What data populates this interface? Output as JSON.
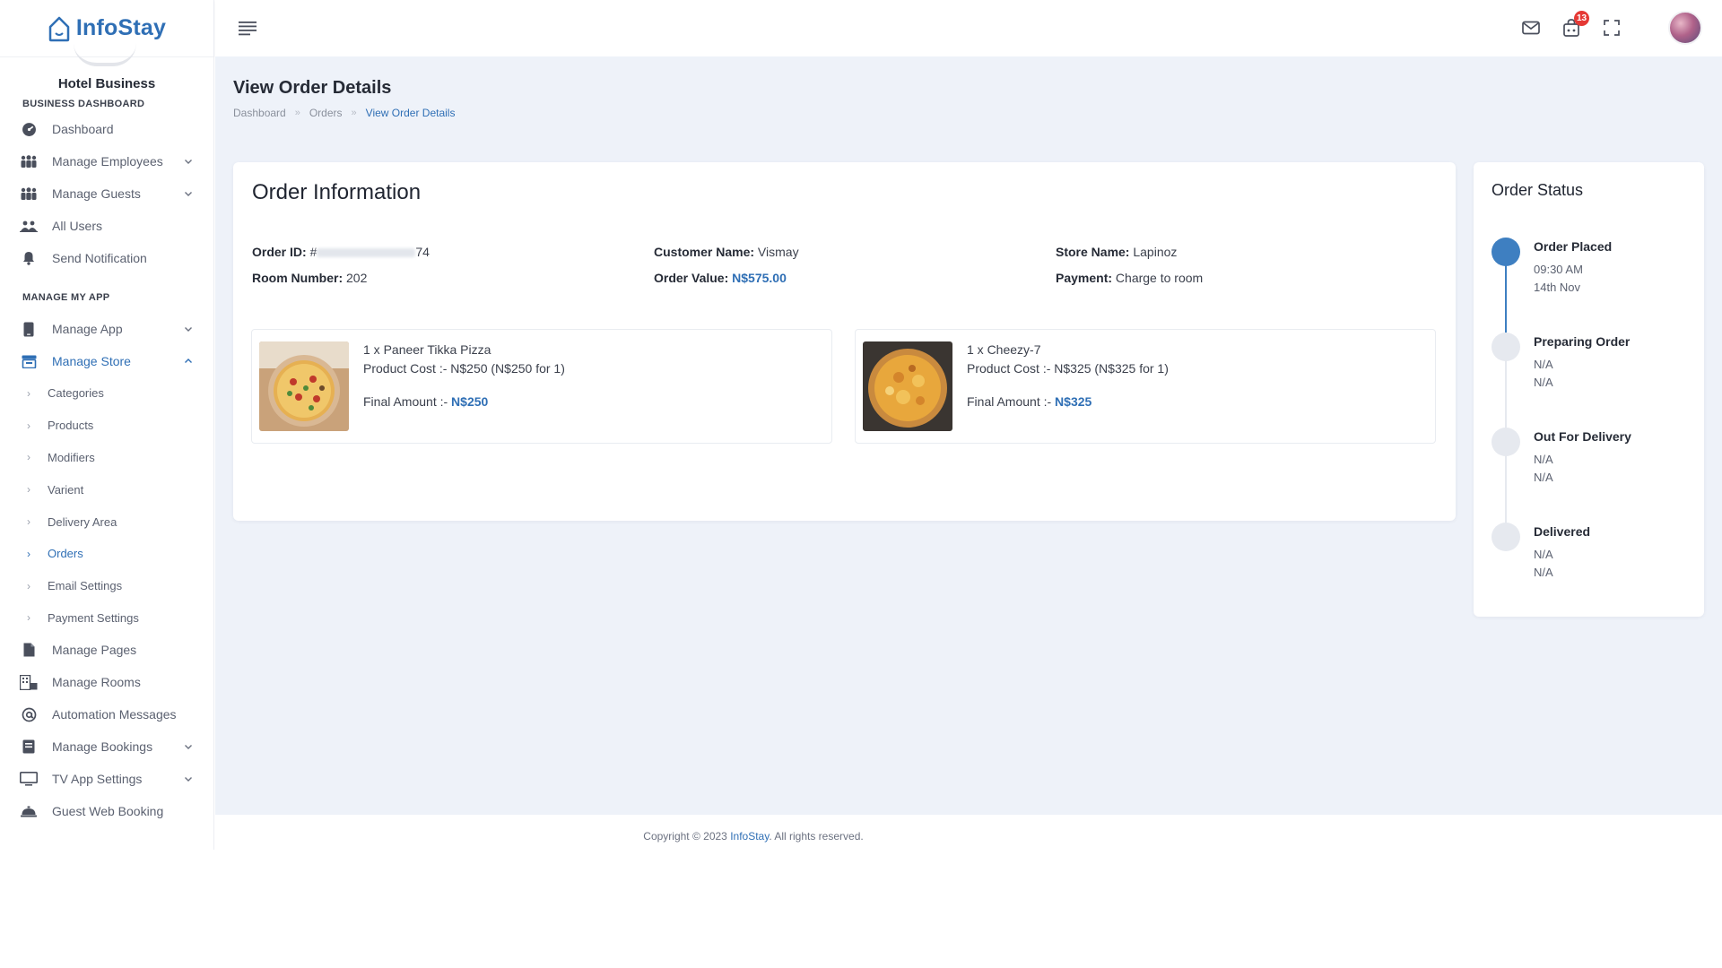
{
  "brand": {
    "name": "InfoStay"
  },
  "business_name": "Hotel Business",
  "sidebar": {
    "section1": "BUSINESS DASHBOARD",
    "items1": [
      {
        "label": "Dashboard",
        "icon": "dashboard-icon"
      },
      {
        "label": "Manage Employees",
        "icon": "users-group-icon"
      },
      {
        "label": "Manage Guests",
        "icon": "users-group-icon"
      },
      {
        "label": "All Users",
        "icon": "users-icon"
      },
      {
        "label": "Send Notification",
        "icon": "bell-icon"
      }
    ],
    "section2": "MANAGE MY APP",
    "items2": [
      {
        "label": "Manage App",
        "icon": "mobile-icon"
      },
      {
        "label": "Manage Store",
        "icon": "store-icon"
      }
    ],
    "store_sub": [
      {
        "label": "Categories"
      },
      {
        "label": "Products"
      },
      {
        "label": "Modifiers"
      },
      {
        "label": "Varient"
      },
      {
        "label": "Delivery Area"
      },
      {
        "label": "Orders"
      },
      {
        "label": "Email Settings"
      },
      {
        "label": "Payment Settings"
      }
    ],
    "items3": [
      {
        "label": "Manage Pages",
        "icon": "file-icon"
      },
      {
        "label": "Manage Rooms",
        "icon": "building-icon"
      },
      {
        "label": "Automation Messages",
        "icon": "at-icon"
      },
      {
        "label": "Manage Bookings",
        "icon": "book-icon"
      },
      {
        "label": "TV App Settings",
        "icon": "monitor-icon"
      },
      {
        "label": "Guest Web Booking",
        "icon": "bell-concierge-icon"
      }
    ]
  },
  "topbar": {
    "cart_badge": "13"
  },
  "page": {
    "title": "View Order Details",
    "breadcrumb": [
      "Dashboard",
      "Orders",
      "View Order Details"
    ],
    "breadcrumb_sep": "»"
  },
  "order": {
    "heading": "Order Information",
    "order_id_label": "Order ID:",
    "order_id_prefix": "#",
    "order_id_suffix": "74",
    "room_label": "Room Number:",
    "room_value": "202",
    "customer_label": "Customer Name:",
    "customer_value": "Vismay",
    "order_value_label": "Order Value:",
    "order_value": "N$575.00",
    "store_label": "Store Name:",
    "store_value": "Lapinoz",
    "payment_label": "Payment:",
    "payment_value": "Charge to room",
    "items": [
      {
        "title": "1 x Paneer Tikka Pizza",
        "cost": "Product Cost :- N$250 (N$250 for 1)",
        "final_label": "Final Amount :-",
        "final_value": "N$250"
      },
      {
        "title": "1 x Cheezy-7",
        "cost": "Product Cost :- N$325 (N$325 for 1)",
        "final_label": "Final Amount :-",
        "final_value": "N$325"
      }
    ]
  },
  "status": {
    "heading": "Order Status",
    "steps": [
      {
        "label": "Order Placed",
        "line1": "09:30 AM",
        "line2": "14th Nov",
        "done": true
      },
      {
        "label": "Preparing Order",
        "line1": "N/A",
        "line2": "N/A",
        "done": false
      },
      {
        "label": "Out For Delivery",
        "line1": "N/A",
        "line2": "N/A",
        "done": false
      },
      {
        "label": "Delivered",
        "line1": "N/A",
        "line2": "N/A",
        "done": false
      }
    ]
  },
  "footer": {
    "prefix": "Copyright © 2023 ",
    "brand": "InfoStay",
    "suffix": ". All rights reserved."
  },
  "colors": {
    "accent": "#2f6fb5",
    "timeline_active": "#3e7fc1",
    "badge": "#e53935",
    "main_bg": "#eef2f9"
  }
}
